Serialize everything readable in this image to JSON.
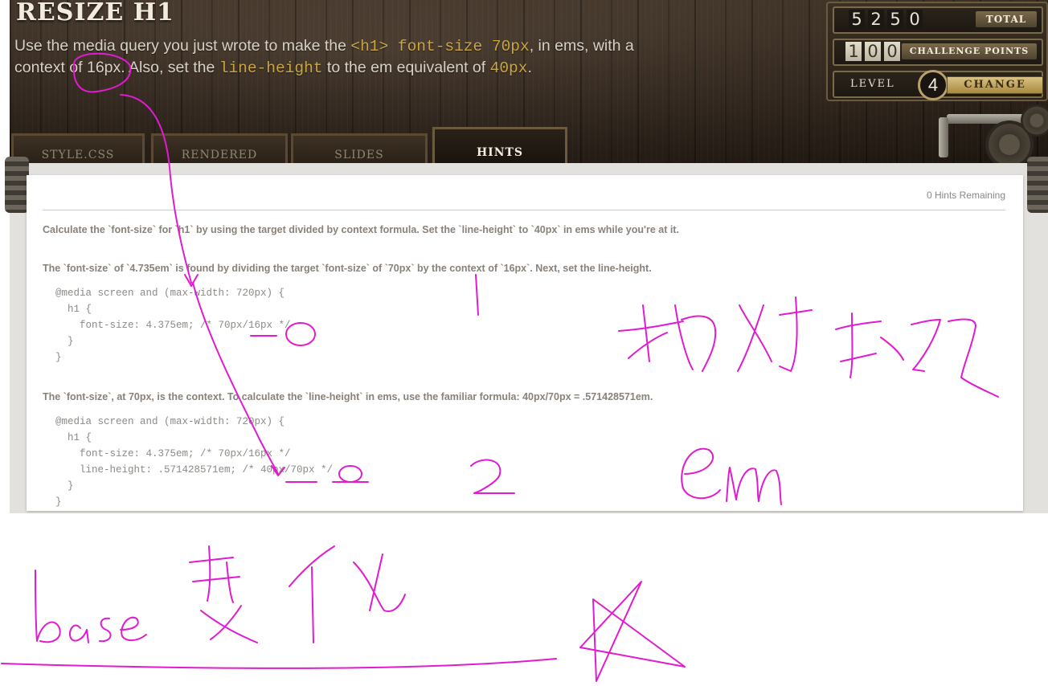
{
  "header": {
    "title": "RESIZE H1",
    "instructions": [
      {
        "text": "Use the media query you just wrote to make the ",
        "code": false
      },
      {
        "text": "<h1> font-size 70px",
        "code": true
      },
      {
        "text": ", in ems, with a context of 16px. Also, set the ",
        "code": false
      },
      {
        "text": "line-height",
        "code": true
      },
      {
        "text": " to the em equivalent of ",
        "code": false
      },
      {
        "text": "40px",
        "code": true
      },
      {
        "text": ".",
        "code": false
      }
    ]
  },
  "stats": {
    "total_digits": [
      "5",
      "2",
      "5",
      "0"
    ],
    "total_label": "TOTAL",
    "challenge_digits": [
      "1",
      "0",
      "0"
    ],
    "challenge_label": "CHALLENGE POINTS",
    "level_label": "LEVEL",
    "level_value": "4",
    "change_label": "CHANGE"
  },
  "tabs": [
    {
      "label": "STYLE.CSS",
      "active": false
    },
    {
      "label": "RENDERED",
      "active": false
    },
    {
      "label": "SLIDES",
      "active": false
    },
    {
      "label": "HINTS",
      "active": true
    }
  ],
  "hints": {
    "remaining": "0 Hints Remaining",
    "hint1": "Calculate the `font-size` for `h1` by using the target divided by context formula. Set the `line-height` to `40px` in ems while you're at it.",
    "hint2": "The `font-size` of `4.735em` is found by dividing the target `font-size` of `70px` by the context of `16px`. Next, set the line-height.",
    "code1": "@media screen and (max-width: 720px) {\n  h1 {\n    font-size: 4.375em; /* 70px/16px */\n  }\n}",
    "hint3": "The `font-size`, at 70px, is the context. To calculate the `line-height` in ems, use the familiar formula: 40px/70px = .571428571em.",
    "code2": "@media screen and (max-width: 720px) {\n  h1 {\n    font-size: 4.375em; /* 70px/16px */\n    line-height: .571428571em; /* 40px/70px */\n  }\n}"
  },
  "colors": {
    "ink": "#e01bd0",
    "code_highlight": "#c9a642"
  }
}
